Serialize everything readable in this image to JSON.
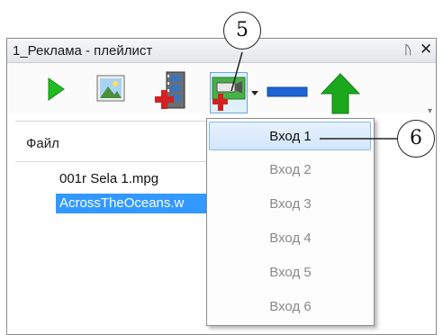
{
  "panel": {
    "title": "1_Реклама - плейлист",
    "pin_glyph": "ᚢ",
    "close_glyph": "✕"
  },
  "toolbar": {
    "buttons": [
      {
        "icon": "play-icon"
      },
      {
        "icon": "image-icon"
      },
      {
        "icon": "add-video-icon"
      },
      {
        "icon": "add-input-icon"
      },
      {
        "icon": "dropdown-arrow-icon"
      },
      {
        "icon": "remove-icon"
      },
      {
        "icon": "move-up-icon"
      }
    ]
  },
  "list": {
    "column_header": "Файл",
    "rows": [
      {
        "text": "001r Sela 1.mpg",
        "selected": false
      },
      {
        "text": "AcrossTheOceans.w",
        "selected": true
      }
    ]
  },
  "menu": {
    "items": [
      {
        "label": "Вход 1",
        "enabled": true
      },
      {
        "label": "Вход 2",
        "enabled": false
      },
      {
        "label": "Вход 3",
        "enabled": false
      },
      {
        "label": "Вход 4",
        "enabled": false
      },
      {
        "label": "Вход 5",
        "enabled": false
      },
      {
        "label": "Вход 6",
        "enabled": false
      }
    ]
  },
  "callouts": {
    "c5": "5",
    "c6": "6"
  },
  "colors": {
    "selection": "#3399ff",
    "play": "#22bb22",
    "remove": "#1f64d6",
    "up_arrow": "#1ca81c",
    "add_red": "#d32020"
  }
}
